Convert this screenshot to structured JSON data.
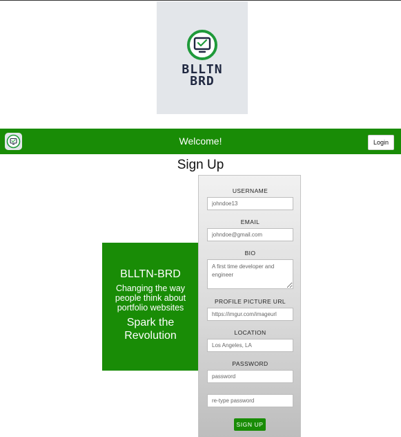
{
  "brand": {
    "logo_line1": "BLLTN",
    "logo_line2": "BRD",
    "accent_color": "#198c06",
    "logo_ring_color": "#1f9a3a",
    "logo_dark_color": "#1f2740"
  },
  "navbar": {
    "title": "Welcome!",
    "login_label": "Login"
  },
  "page": {
    "title": "Sign Up"
  },
  "promo": {
    "title": "BLLTN-BRD",
    "subtitle": "Changing the way people think about portfolio websites",
    "cta": "Spark the Revolution"
  },
  "form": {
    "username_label": "USERNAME",
    "username_placeholder": "johndoe13",
    "email_label": "EMAIL",
    "email_placeholder": "johndoe@gmail.com",
    "bio_label": "BIO",
    "bio_placeholder": "A first time developer and engineer",
    "picture_label": "PROFILE PICTURE URL",
    "picture_placeholder": "https://imgur.com/imageurl",
    "location_label": "LOCATION",
    "location_placeholder": "Los Angeles, LA",
    "password_label": "PASSWORD",
    "password_placeholder": "password",
    "retype_placeholder": "re-type password",
    "submit_label": "SIGN UP"
  },
  "icons": {
    "logo": "monitor-check-icon"
  }
}
